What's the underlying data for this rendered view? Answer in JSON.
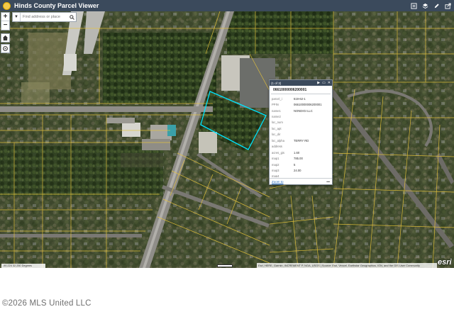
{
  "header": {
    "title": "Hinds County Parcel Viewer",
    "tools": [
      "legend-icon",
      "layers-icon",
      "edit-icon",
      "share-icon"
    ]
  },
  "search": {
    "placeholder": "Find address or place"
  },
  "map_controls": {
    "zoom_in": "+",
    "zoom_out": "−"
  },
  "popup": {
    "counter": "(1 of 3)",
    "parcel_title": "06610000006200001",
    "fields": [
      {
        "key": "parcel_i",
        "value": "619-62-1"
      },
      {
        "key": "PPIN",
        "value": "06610000006200001"
      },
      {
        "key": "name1",
        "value": "NONDIGI LLC"
      },
      {
        "key": "name2",
        "value": ""
      },
      {
        "key": "loc_num",
        "value": ""
      },
      {
        "key": "loc_apt",
        "value": ""
      },
      {
        "key": "loc_dir",
        "value": ""
      },
      {
        "key": "loc_alpha",
        "value": "TERRY RD"
      },
      {
        "key": "address",
        "value": ""
      },
      {
        "key": "acres_gis",
        "value": "1.60"
      },
      {
        "key": "map1",
        "value": "785.00"
      },
      {
        "key": "map2",
        "value": "5"
      },
      {
        "key": "map3",
        "value": "24.00"
      },
      {
        "key": "map4",
        "value": ""
      }
    ],
    "zoom_to": "Zoom to",
    "more": "•••"
  },
  "attribution": "Esri, HERE, Garmin, INCREMENT P, NGA, USGS | Source: Esri, Vexcel, Earthstar Geographics, IGN, and the GIS User Community",
  "esri_logo": "esri",
  "coords": "-90.224 32.250 Degrees",
  "watermark": "©2026 MLS United LLC",
  "colors": {
    "header_bg": "#3b4a5c",
    "selection_outline": "#00e5ff",
    "parcel_lines": "#e8c43a"
  }
}
